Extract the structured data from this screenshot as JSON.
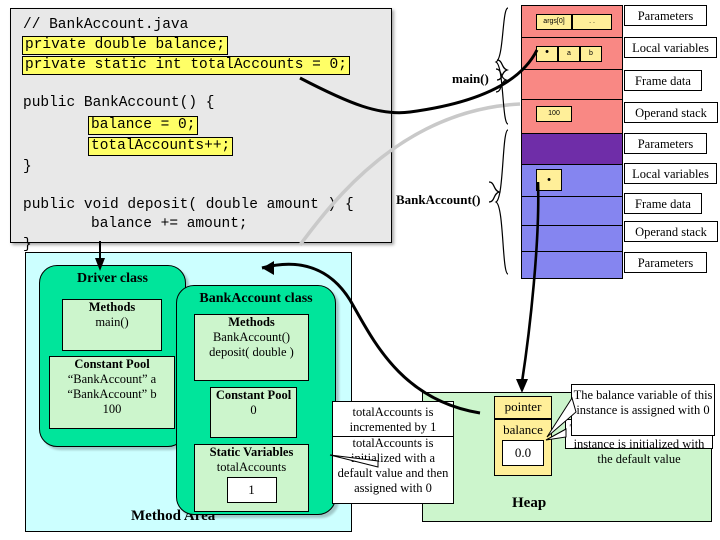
{
  "code_panel": {
    "lines": [
      {
        "text": "// BankAccount.java",
        "hl": false
      },
      {
        "text": "private double balance;",
        "hl": true
      },
      {
        "text": "private static int totalAccounts = 0;",
        "hl": true
      },
      {
        "text": "public BankAccount() {",
        "hl": false
      },
      {
        "text": "balance = 0;",
        "hl": true
      },
      {
        "text": "totalAccounts++;",
        "hl": true
      },
      {
        "text": "}",
        "hl": false
      },
      {
        "text": "public void deposit( double amount ) {",
        "hl": false
      },
      {
        "text": "balance += amount;",
        "hl": false
      },
      {
        "text": "}",
        "hl": false
      }
    ]
  },
  "stack": {
    "frames": [
      {
        "name": "main()",
        "color": "#f98884",
        "rows": [
          {
            "label": "Parameters",
            "slots": [
              "args[0]",
              ". ."
            ]
          },
          {
            "label": "Local variables",
            "slots": [
              "•",
              "a",
              "b"
            ]
          },
          {
            "label": "Frame data",
            "slots": []
          },
          {
            "label": "Operand stack",
            "slots": [
              "100"
            ]
          }
        ]
      },
      {
        "name": "BankAccount()",
        "color": "#8585f0",
        "rows": [
          {
            "label": "Parameters",
            "slots": []
          },
          {
            "label": "Local variables",
            "slots": [
              "•"
            ]
          },
          {
            "label": "Frame data",
            "slots": []
          },
          {
            "label": "Operand stack",
            "slots": []
          },
          {
            "label": "Parameters",
            "slots": []
          }
        ]
      }
    ],
    "labels": [
      "Parameters",
      "Local variables",
      "Frame data",
      "Operand stack",
      "Parameters",
      "Local variables",
      "Frame data",
      "Operand stack",
      "Parameters"
    ]
  },
  "method_area": {
    "title": "Method Area",
    "driver_class": {
      "title": "Driver class",
      "methods": {
        "title": "Methods",
        "items": [
          "main()"
        ]
      },
      "constant_pool": {
        "title": "Constant Pool",
        "items": [
          "“BankAccount” a",
          "“BankAccount” b",
          "100"
        ]
      }
    },
    "bankaccount_class": {
      "title": "BankAccount class",
      "methods": {
        "title": "Methods",
        "items": [
          "BankAccount()",
          "deposit( double )"
        ]
      },
      "constant_pool": {
        "title": "Constant Pool",
        "items": [
          "0"
        ]
      },
      "static_variables": {
        "title": "Static Variables",
        "name": "totalAccounts",
        "value": "1"
      }
    }
  },
  "heap": {
    "title": "Heap",
    "object": {
      "pointer_label": "pointer",
      "balance_label": "balance",
      "balance_value": "0.0"
    }
  },
  "callouts": {
    "total_accounts_init": "totalAccounts is initialized with a default value and then assigned with 0",
    "total_accounts_increment": "totalAccounts is incremented by 1",
    "balance_default": "The balance variable of this instance is initialized with the default value",
    "balance_assigned": "The balance variable of this instance is assigned with 0"
  },
  "colors": {
    "code_bg": "#e8e8e8",
    "highlight": "#ffff66",
    "frame_main": "#f98884",
    "frame_params_purple": "#6f2da8",
    "frame_bankaccount": "#8585f0",
    "method_area": "#ccffff",
    "class_box": "#00e59b",
    "inner_box": "#ccf5cc",
    "heap_bg": "#ccf5cc",
    "slot": "#ffef99"
  }
}
